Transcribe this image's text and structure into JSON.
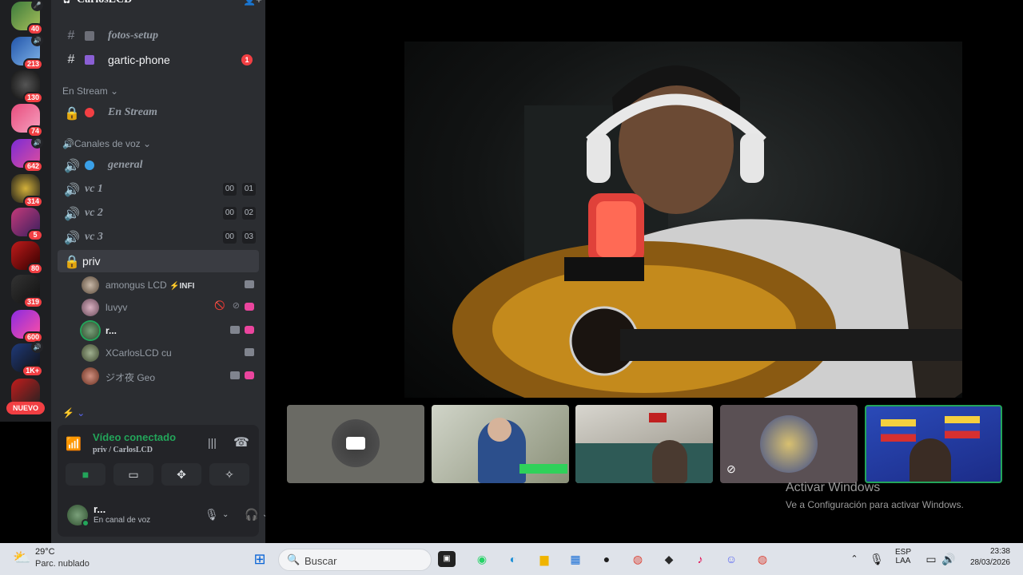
{
  "server_rail": {
    "servers": [
      {
        "count": "40"
      },
      {
        "count": "213"
      },
      {
        "count": "130"
      },
      {
        "count": "74"
      },
      {
        "count": "642"
      },
      {
        "count": "314"
      },
      {
        "count": "5"
      },
      {
        "count": "80"
      },
      {
        "count": "319"
      },
      {
        "count": "600"
      },
      {
        "count": "1K+"
      }
    ],
    "new_badge": "NUEVO"
  },
  "sidebar": {
    "server_name": "CarlosLCD",
    "channels_top": [
      {
        "name": "fotos-setup"
      },
      {
        "name": "gartic-phone",
        "badge": "1"
      }
    ],
    "stream_category": "En Stream",
    "stream_channel": "En Stream",
    "voice_category": "Canales de voz",
    "voice_channels": [
      {
        "name": "general"
      },
      {
        "name": "vc 1",
        "c1": "00",
        "c2": "01"
      },
      {
        "name": "vc 2",
        "c1": "00",
        "c2": "02"
      },
      {
        "name": "vc 3",
        "c1": "00",
        "c2": "03"
      }
    ],
    "priv_channel": "priv",
    "priv_users": [
      {
        "name": "amongus LCD",
        "tag": "⚡INFI"
      },
      {
        "name": "luvyv"
      },
      {
        "name": "r..."
      },
      {
        "name": "XCarlosLCD cu"
      },
      {
        "name": "ジオ夜 Geo"
      }
    ]
  },
  "voice_panel": {
    "status": "Vídeo conectado",
    "location": "priv / CarlosLCD"
  },
  "user_panel": {
    "name": "r...",
    "status": "En canal de voz"
  },
  "watermark": {
    "title": "Activar Windows",
    "subtitle": "Ve a Configuración para activar Windows."
  },
  "taskbar": {
    "temp": "29°C",
    "weather": "Parc. nublado",
    "search_placeholder": "Buscar",
    "lang1": "ESP",
    "lang2": "LAA",
    "time": "23:38",
    "date": "28/03/2026"
  }
}
